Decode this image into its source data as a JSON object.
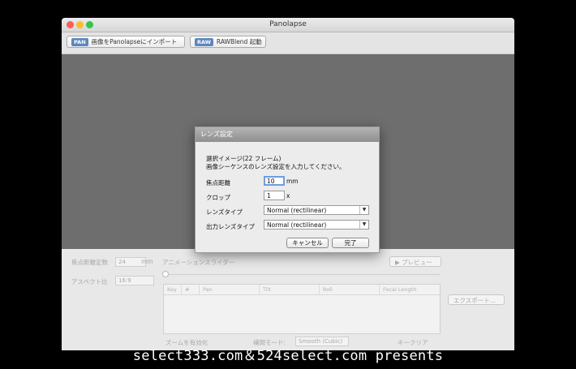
{
  "window": {
    "title": "Panolapse"
  },
  "toolbar": {
    "import_badge": "PAN",
    "import_label": "画像をPanolapseにインポート",
    "rawblend_badge": "RAW",
    "rawblend_label": "RAWBlend 起動"
  },
  "panel": {
    "focal_label": "焦点距離定数",
    "focal_value": "24",
    "focal_unit": "mm",
    "aspect_label": "アスペクト比",
    "aspect_value": "16:9",
    "animation_label": "アニメーションスライダー",
    "preview_label": "▶ プレビュー",
    "export_label": "エクスポート...",
    "columns": [
      "Key",
      "#",
      "Pan",
      "Tilt",
      "Roll",
      "Focal Length"
    ],
    "zoom_label": "ズームを有効化",
    "interp_label": "補間モード:",
    "interp_value": "Smooth (Cubic)",
    "clear_label": "キークリア"
  },
  "dialog": {
    "title": "レンズ設定",
    "message_line1": "選択イメージ(22 フレーム)",
    "message_line2": "画像シーケンスのレンズ設定を入力してください。",
    "focal_label": "焦点距離",
    "focal_value": "10",
    "focal_unit": "mm",
    "crop_label": "クロップ",
    "crop_value": "1",
    "crop_unit": "x",
    "lens_type_label": "レンズタイプ",
    "lens_type_value": "Normal (rectilinear)",
    "output_lens_label": "出力レンズタイプ",
    "output_lens_value": "Normal (rectilinear)",
    "cancel_label": "キャンセル",
    "done_label": "完了"
  },
  "footer": {
    "text": "select333.com＆524select.com presents"
  }
}
